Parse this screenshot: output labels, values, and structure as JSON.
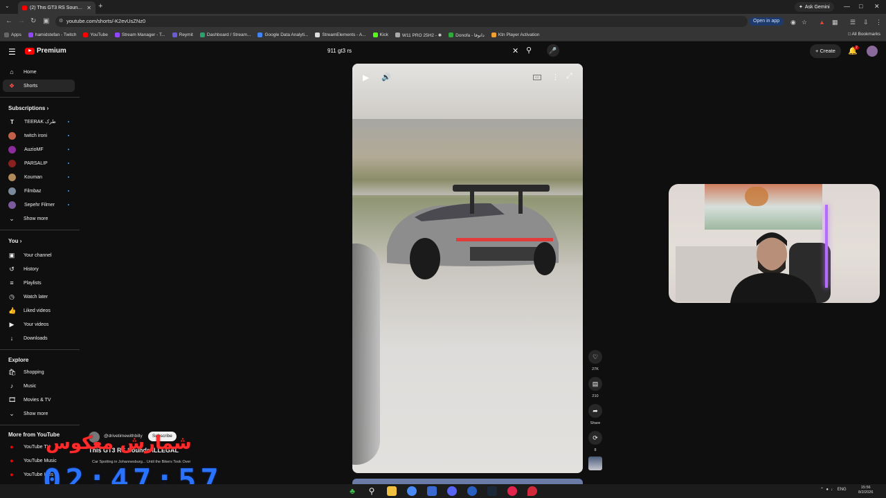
{
  "browser": {
    "tab_title": "(2) This GT3 RS Sounds ILLEGAL",
    "url": "youtube.com/shorts/-K2evUsZNz0",
    "ask_gemini": "Ask Gemini",
    "open_in_app": "Open in app",
    "all_bookmarks": "All Bookmarks",
    "bookmarks": [
      {
        "label": "Apps"
      },
      {
        "label": "hamidstefan - Twitch"
      },
      {
        "label": "YouTube"
      },
      {
        "label": "Stream Manager - T..."
      },
      {
        "label": "Reymit"
      },
      {
        "label": "Dashboard / Stream..."
      },
      {
        "label": "Google Data Analyti..."
      },
      {
        "label": "StreamElements - A..."
      },
      {
        "label": "Kick"
      },
      {
        "label": "W11 PRO 25H2 - ✱"
      },
      {
        "label": "Donofa - دانوفا"
      },
      {
        "label": "Ktn Player Activation"
      }
    ]
  },
  "header": {
    "logo_text": "Premium",
    "search_value": "911 gt3 rs",
    "create_label": "Create",
    "notification_count": "2"
  },
  "sidebar": {
    "main": [
      {
        "label": "Home",
        "icon": "home-icon"
      },
      {
        "label": "Shorts",
        "icon": "shorts-icon"
      }
    ],
    "subscriptions_title": "Subscriptions",
    "subscriptions": [
      {
        "label": "TEERAK طرک",
        "color": "#111111"
      },
      {
        "label": "twitch ironi",
        "color": "#c0604a"
      },
      {
        "label": "AuzioMF",
        "color": "#8a2c9a"
      },
      {
        "label": "PARSALIP",
        "color": "#8a2020"
      },
      {
        "label": "Kouman",
        "color": "#b08a5a"
      },
      {
        "label": "Filmbaz",
        "color": "#7a8a9a"
      },
      {
        "label": "Sepehr Filmer",
        "color": "#7a5a9a"
      }
    ],
    "show_more": "Show more",
    "you_title": "You",
    "you": [
      {
        "label": "Your channel"
      },
      {
        "label": "History"
      },
      {
        "label": "Playlists"
      },
      {
        "label": "Watch later"
      },
      {
        "label": "Liked videos"
      },
      {
        "label": "Your videos"
      },
      {
        "label": "Downloads"
      }
    ],
    "explore_title": "Explore",
    "explore": [
      {
        "label": "Shopping"
      },
      {
        "label": "Music"
      },
      {
        "label": "Movies & TV"
      }
    ],
    "explore_show_more": "Show more",
    "more_title": "More from YouTube",
    "more": [
      {
        "label": "YouTube TV"
      },
      {
        "label": "YouTube Music"
      },
      {
        "label": "YouTube Kids"
      }
    ]
  },
  "video": {
    "channel": "@drivetimewithbilly",
    "subscribe_label": "Subscribe",
    "title": "This GT3 RS Sounds ILLEGAL",
    "subtitle": "Car Spotting in Johannesburg... Until the Bikers Took Over",
    "likes": "27K",
    "comments": "210",
    "share_label": "Share",
    "remix_count": "8"
  },
  "overlay": {
    "persian_text": "شمارش معکوس",
    "timer": "02:47:57"
  },
  "taskbar": {
    "lang": "ENG",
    "time": "15:56",
    "date": "8/2/2026"
  }
}
